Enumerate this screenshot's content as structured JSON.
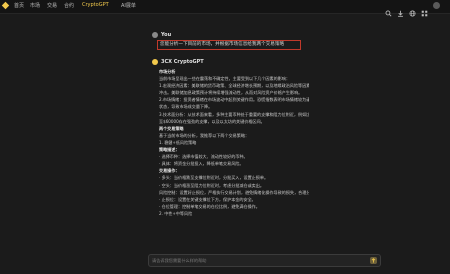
{
  "topbar": {
    "nav": [
      "首页",
      "市场",
      "交易",
      "合约",
      "CryptoGPT",
      "AI展单"
    ],
    "active_index": 4,
    "icons": [
      "search-icon",
      "download-icon",
      "globe-icon",
      "user-icon",
      "grid-icon"
    ]
  },
  "conversation": {
    "user": {
      "name": "You",
      "message": "您能分析一下目前的市场，并根据市场信息给我两个交易策略"
    },
    "assistant": {
      "name": "3CX CryptoGPT",
      "lines": [
        {
          "t": "市场分析",
          "b": true
        },
        {
          "t": "当前市场呈现出一些在震荡和不确定性，主要受到以下几个因素的影响："
        },
        {
          "t": "1.宏观经济因素：美联储的货币政策、全球经济增长预期，以及地缘政治风险等因素对加密货币市场造成"
        },
        {
          "t": "冲击。美联储加息政策预计将持续增强流动性，从而对风险资产价格产生影响。"
        },
        {
          "t": "2.市场情绪：投资者情绪在市场波动中起到关键作用。恐慌指数表明市场情绪较为谨慎，部分投资者选择观望"
        },
        {
          "t": "状态，导致市场成交量下降。"
        },
        {
          "t": "3.技术面分析：从技术面来看，多种主要币种处于重要的支撑和阻力位附近，例如比特币在$58,000附近"
        },
        {
          "t": "至$60000存在强劲的支撑，以及以太坊的关键价格区间。"
        },
        {
          "t": "两个交易策略",
          "b": true
        },
        {
          "t": "基于当前市场的分析，我推荐以下两个交易策略："
        },
        {
          "t": "1. 稳健+低风险策略"
        },
        {
          "t": "策略描述：",
          "b": true
        },
        {
          "t": "· 选择币种：选择市值较大、流动性较好的币种。"
        },
        {
          "t": "· 具体：将资金分批投入，降低单笔交易风险。"
        },
        {
          "t": "交易操作：",
          "b": true
        },
        {
          "t": "· 多头：当价格跌至支撑位附近时，分批买入，设置止损单。"
        },
        {
          "t": "· 空头：当价格涨至阻力位附近时，考虑分批减仓或卖出。"
        },
        {
          "t": "风险控制：设置好止损位，严格执行交易计划，避免情绪化操作导致的损失，合理分配仓位以控制整体风险。"
        },
        {
          "t": "· 止损位：设置在关键支撑位下方，保护本金的安全。"
        },
        {
          "t": "· 仓位管理：控制单笔交易的仓位比例，避免满仓操作。"
        },
        {
          "t": "2. 中性+中等风险"
        }
      ]
    }
  },
  "chat_input": {
    "placeholder": "请告诉我您需要什么样的帮助",
    "value": ""
  },
  "colors": {
    "background": "#1b1b1b",
    "accent": "#f2c94c",
    "highlight_border": "#c0392b"
  }
}
